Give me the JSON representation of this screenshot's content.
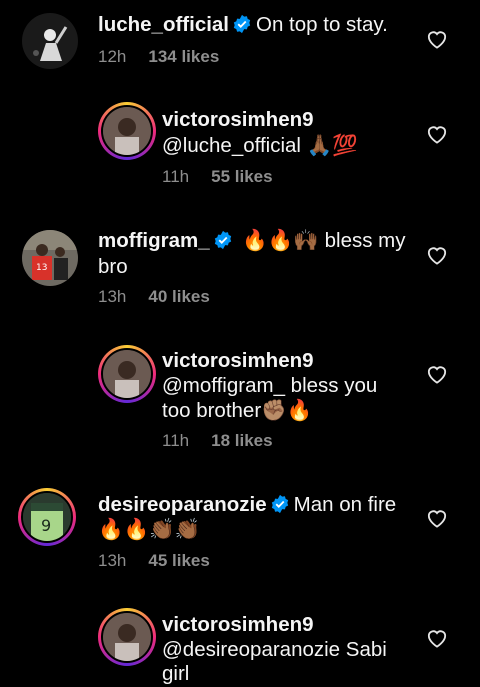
{
  "comments": [
    {
      "username": "luche_official",
      "verified": true,
      "text": "On top to stay.",
      "time": "12h",
      "likes": "134 likes"
    },
    {
      "username": "victorosimhen9",
      "text": "@luche_official 🙏🏾💯",
      "time": "11h",
      "likes": "55 likes"
    },
    {
      "username": "moffigram_",
      "verified": true,
      "text_line1": "🔥🔥🙌🏾 bless my",
      "text_line2": "bro",
      "time": "13h",
      "likes": "40 likes"
    },
    {
      "username": "victorosimhen9",
      "text_line1": "@moffigram_ bless you",
      "text_line2": "too brother✊🏽🔥",
      "time": "11h",
      "likes": "18 likes"
    },
    {
      "username": "desireoparanozie",
      "verified": true,
      "text": "Man on fire",
      "text_line2": "🔥🔥👏🏾👏🏾",
      "time": "13h",
      "likes": "45 likes"
    },
    {
      "username": "victorosimhen9",
      "text_line1": "@desireoparanozie Sabi",
      "text_line2": "girl"
    }
  ],
  "icons": {
    "verified": "verified-badge-icon",
    "like": "heart-outline-icon"
  },
  "colors": {
    "background": "#000000",
    "verified": "#0095f6",
    "muted": "#8e8e8e"
  }
}
